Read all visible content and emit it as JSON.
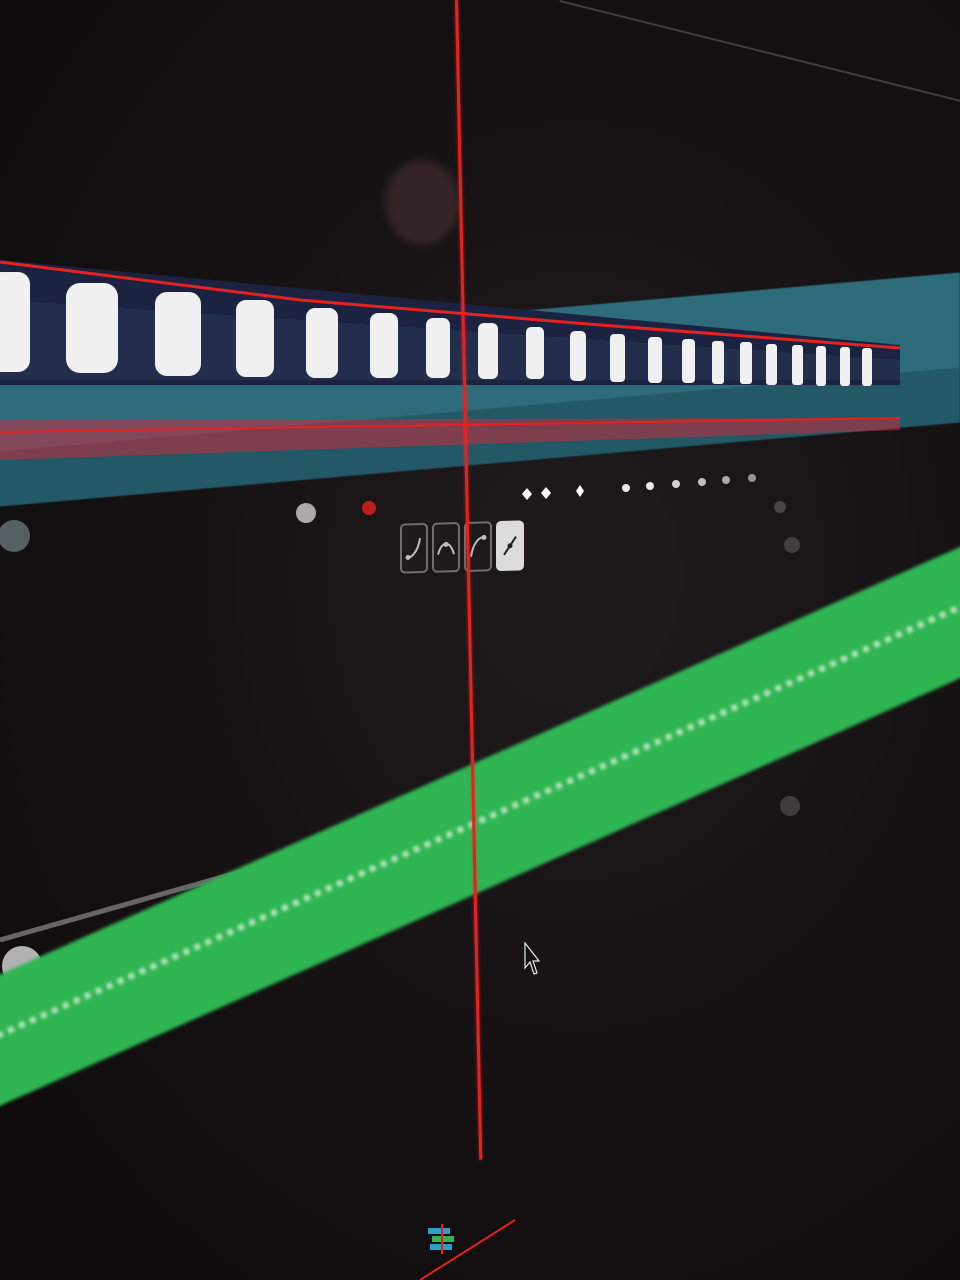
{
  "app": {
    "view": "curve-editor",
    "playhead_color": "#e4221f"
  },
  "curve_tools": [
    {
      "name": "ease-in-icon",
      "active": false
    },
    {
      "name": "ease-in-out-icon",
      "active": false
    },
    {
      "name": "ease-out-icon",
      "active": false
    },
    {
      "name": "linear-icon",
      "active": true
    }
  ],
  "colors": {
    "video_track": "#2e6c7c",
    "audio_track": "#2fb552",
    "curve": "#1a2fb8",
    "keyframe": "#f2f2f2",
    "selected_keyframe": "#e4221f",
    "background": "#161214"
  }
}
